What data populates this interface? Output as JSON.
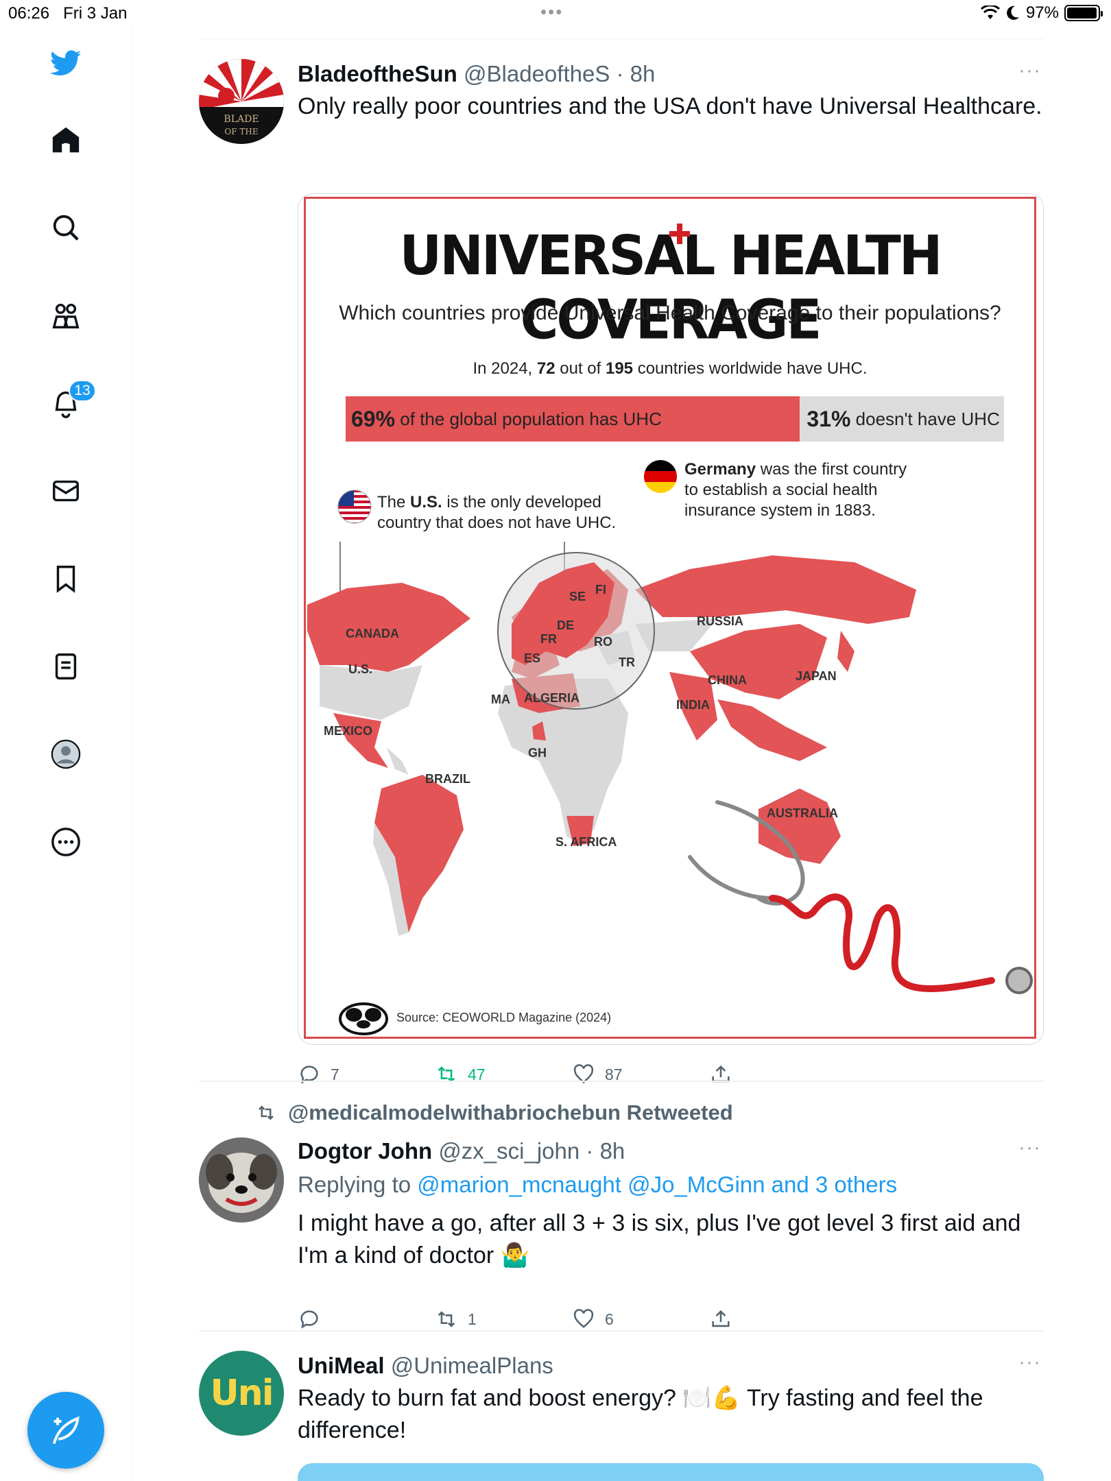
{
  "status_bar": {
    "time": "06:26",
    "date": "Fri 3 Jan",
    "battery": "97%",
    "battery_level": 0.97,
    "menu_dots": "•••"
  },
  "sidebar": {
    "items": [
      {
        "icon": "twitter-bird-icon"
      },
      {
        "icon": "home-icon"
      },
      {
        "icon": "search-icon"
      },
      {
        "icon": "communities-icon"
      },
      {
        "icon": "notifications-icon",
        "badge": "13"
      },
      {
        "icon": "messages-icon"
      },
      {
        "icon": "bookmarks-icon"
      },
      {
        "icon": "lists-icon"
      },
      {
        "icon": "profile-avatar-icon"
      },
      {
        "icon": "more-icon"
      }
    ],
    "compose_icon": "compose-feather-icon"
  },
  "tweets": [
    {
      "name": "BladeoftheSun",
      "handle": "@BladeoftheS",
      "time": "· 8h",
      "more": "···",
      "text": "Only really poor countries and the USA don't have Universal Healthcare.",
      "avatar_label_1": "BLADE",
      "avatar_label_2": "OF THE",
      "media": {
        "title": "UNIVERSAL HEALTH COVERAGE",
        "subtitle": "Which countries provide Universal Health Coverage to their populations?",
        "stat_pre": "In 2024,",
        "stat_72": "72",
        "stat_mid": "out of",
        "stat_195": "195",
        "stat_post": "countries worldwide have UHC.",
        "bar_left_pct": "69%",
        "bar_left_text": "of the global population has UHC",
        "bar_right_pct": "31%",
        "bar_right_text": "doesn't have UHC",
        "us_note_pre": "The",
        "us_note_bold": "U.S.",
        "us_note_rest": "is the only developed country that does not have UHC.",
        "de_note_bold": "Germany",
        "de_note_rest": "was the first country to establish a social health insurance system in 1883.",
        "map_labels": {
          "canada": "CANADA",
          "us": "U.S.",
          "mexico": "MEXICO",
          "brazil": "BRAZIL",
          "russia": "RUSSIA",
          "china": "CHINA",
          "india": "INDIA",
          "japan": "JAPAN",
          "australia": "AUSTRALIA",
          "algeria": "ALGERIA",
          "ma": "MA",
          "gh": "GH",
          "s_africa": "S. AFRICA",
          "se": "SE",
          "fi": "FI",
          "de": "DE",
          "fr": "FR",
          "es": "ES",
          "ro": "RO",
          "tr": "TR"
        },
        "source": "Source: CEOWORLD Magazine (2024)",
        "colors": {
          "uhc": "#e25456",
          "no_uhc": "#d9d9d9"
        }
      },
      "actions": {
        "reply": "7",
        "retweet": "47",
        "like": "87"
      }
    },
    {
      "retweeted_by": "@medicalmodelwithabriochebun Retweeted",
      "name": "Dogtor John",
      "handle": "@zx_sci_john",
      "time": "· 8h",
      "more": "···",
      "replying_prefix": "Replying to",
      "replying_to": "@marion_mcnaught @Jo_McGinn and 3 others",
      "text": "I might have a go, after all 3 + 3 is six, plus I've got level 3 first aid and I'm a kind of doctor 🤷‍♂️",
      "actions": {
        "reply": "",
        "retweet": "1",
        "like": "6"
      }
    },
    {
      "name": "UniMeal",
      "handle": "@UnimealPlans",
      "more": "···",
      "avatar_text": "Uni",
      "text": "Ready to burn fat and boost energy? 🍽️💪 Try fasting and feel the difference!"
    }
  ],
  "colors": {
    "accent": "#1d9bf0",
    "retweet_green": "#00ba7c",
    "muted": "#536471"
  }
}
